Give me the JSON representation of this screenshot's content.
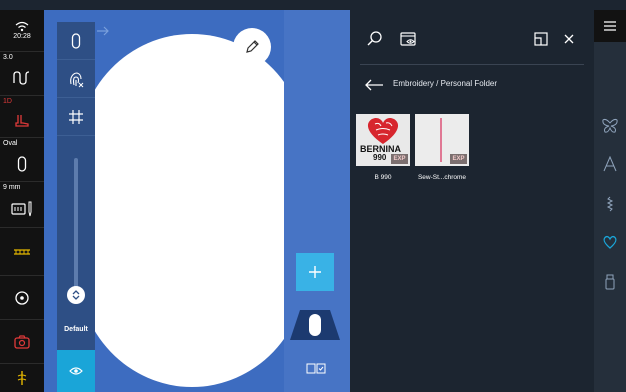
{
  "status_bar": {
    "time": "20:28",
    "stitch_length": "3.0",
    "presser_foot": "1D",
    "hoop_label": "Oval",
    "needle_size": "9 mm"
  },
  "tool_panel": {
    "zoom_label": "Default"
  },
  "browser": {
    "breadcrumb": "Embroidery / Personal Folder",
    "files": [
      {
        "name": "B 990",
        "badge": "EXP",
        "thumb_text_1": "BERNINA",
        "thumb_text_2": "990"
      },
      {
        "name": "Sew-St...chrome",
        "badge": "EXP"
      }
    ]
  },
  "icons": {
    "wifi": "wifi-icon",
    "stitch": "stitch-icon",
    "foot": "presser-foot-icon",
    "hoop": "hoop-icon",
    "needle": "needle-icon",
    "feed_dog": "feed-dog-icon",
    "bobbin": "bobbin-icon",
    "camera": "camera-icon",
    "thread": "thread-icon",
    "search": "search-icon",
    "preview": "preview-icon",
    "window": "window-icon",
    "close": "close-icon",
    "back": "back-arrow-icon",
    "menu": "menu-icon",
    "butterfly": "butterfly-icon",
    "alphabet": "alphabet-icon",
    "stitch_pattern": "stitch-pattern-icon",
    "heart": "heart-icon",
    "usb": "usb-icon"
  },
  "colors": {
    "canvas_blue": "#3d6cc0",
    "accent_cyan": "#1aa5d8",
    "status_red": "#e03a3a",
    "badge": "#7b6f6f"
  }
}
